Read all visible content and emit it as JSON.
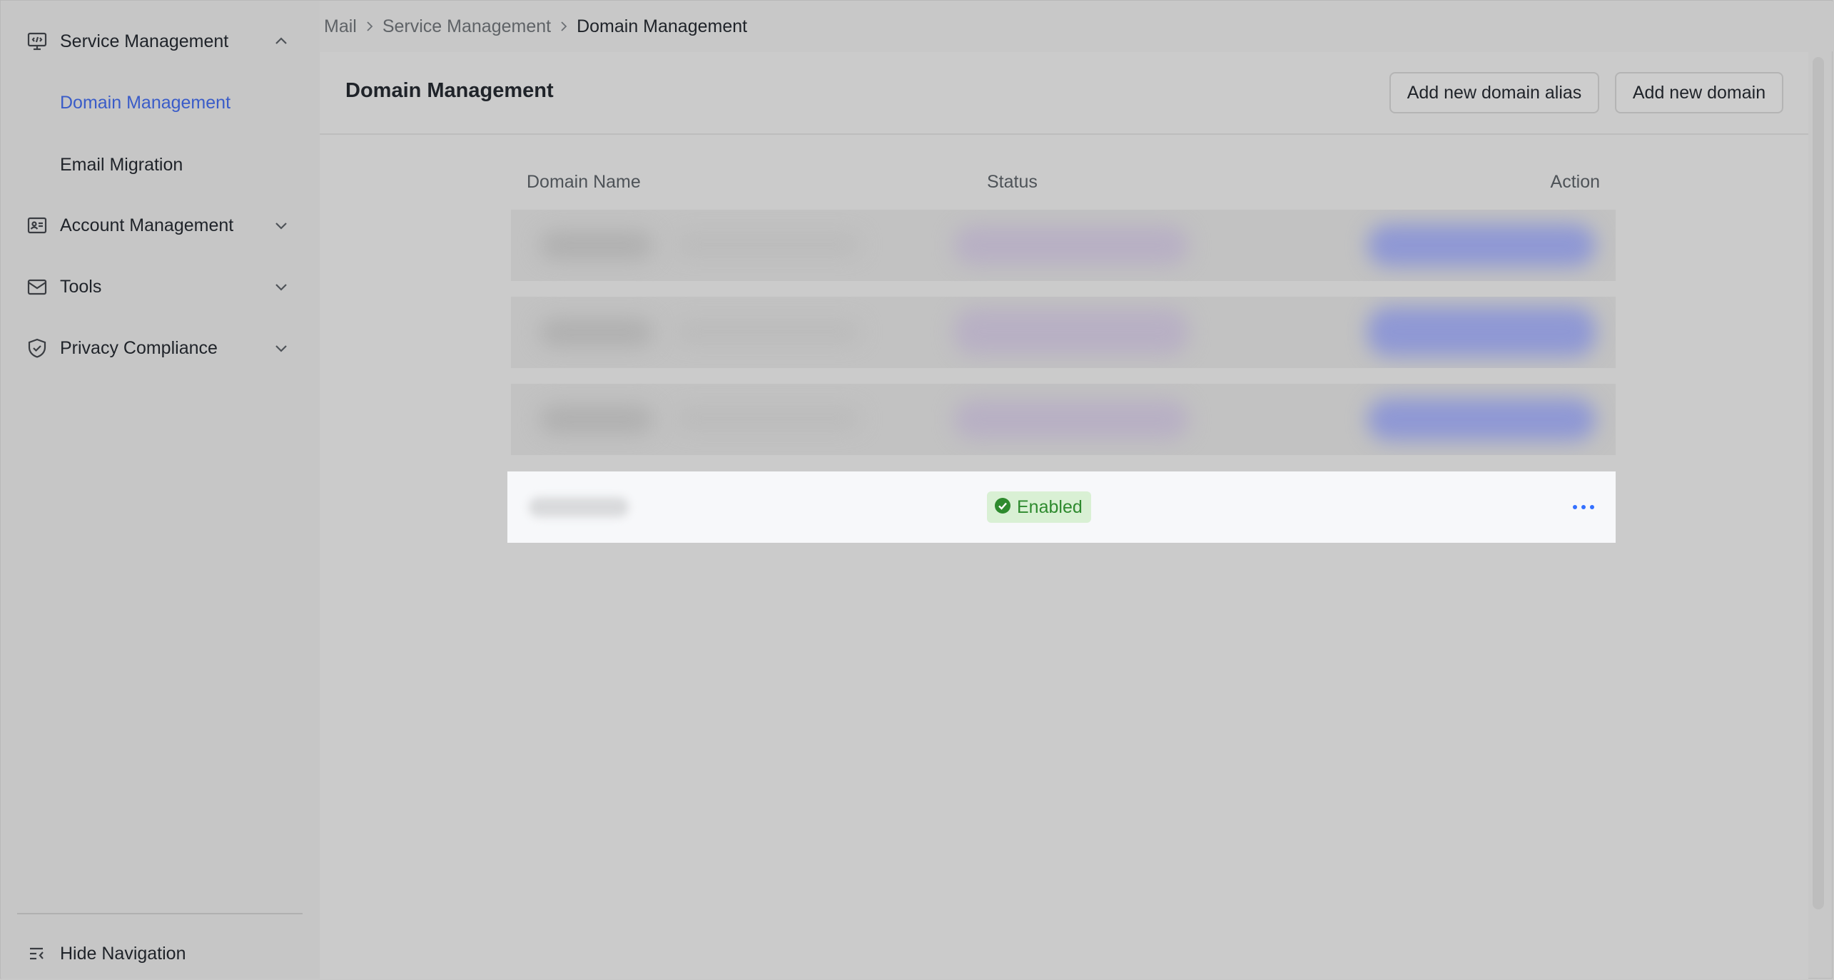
{
  "sidebar": {
    "items": [
      {
        "label": "Service Management",
        "icon": "monitor-code-icon",
        "expanded": true,
        "children": [
          {
            "label": "Domain Management",
            "active": true
          },
          {
            "label": "Email Migration",
            "active": false
          }
        ]
      },
      {
        "label": "Account Management",
        "icon": "id-card-icon",
        "expanded": false
      },
      {
        "label": "Tools",
        "icon": "mail-icon",
        "expanded": false
      },
      {
        "label": "Privacy Compliance",
        "icon": "shield-check-icon",
        "expanded": false
      }
    ],
    "hide_nav_label": "Hide Navigation"
  },
  "breadcrumb": [
    "Mail",
    "Service Management",
    "Domain Management"
  ],
  "main": {
    "title": "Domain Management",
    "add_alias_label": "Add new domain alias",
    "add_domain_label": "Add new domain"
  },
  "table": {
    "columns": [
      "Domain Name",
      "Status",
      "Action"
    ],
    "rows": [
      {
        "status": "Enabled",
        "status_color": "#2e8a2e"
      }
    ]
  },
  "colors": {
    "accent": "#3a5cc8",
    "status_enabled_bg": "#d9f0d4",
    "status_enabled_fg": "#2e8a2e",
    "action_dots": "#3370ff"
  }
}
